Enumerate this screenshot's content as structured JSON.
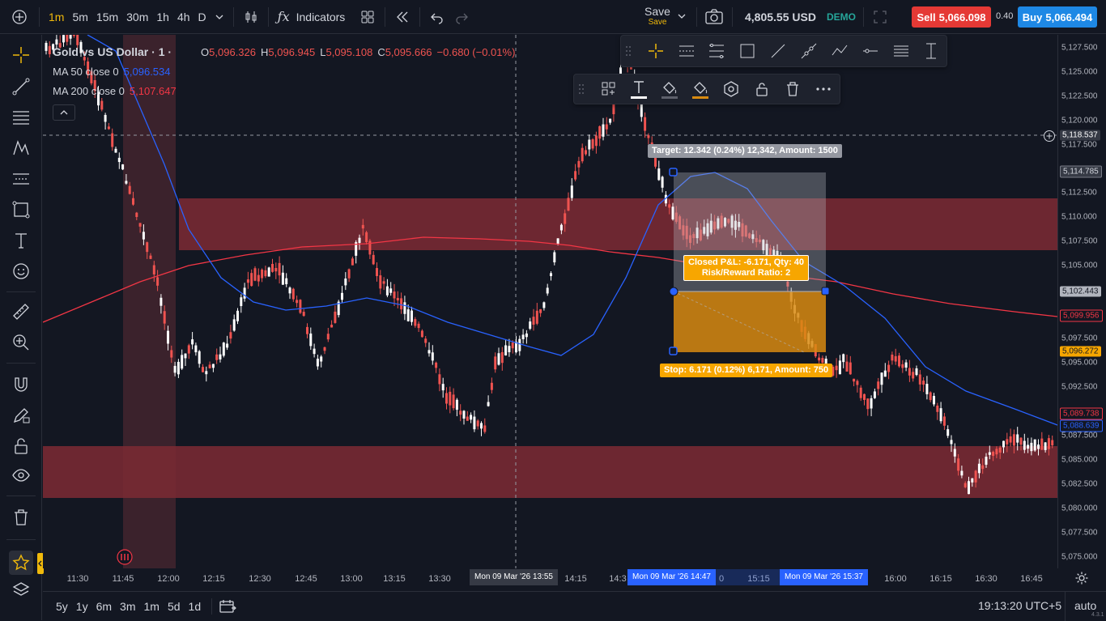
{
  "toolbar": {
    "timeframes": [
      "1m",
      "5m",
      "15m",
      "30m",
      "1h",
      "4h",
      "D"
    ],
    "indicators_label": "Indicators",
    "save_label": "Save",
    "save_sub": "Save",
    "balance": "4,805.55 USD",
    "account_mode": "DEMO",
    "sell_label": "Sell",
    "sell_price": "5,066.098",
    "spread": "0.40",
    "buy_label": "Buy",
    "buy_price": "5,066.494"
  },
  "legend": {
    "symbol": "Gold vs US Dollar · 1 ·",
    "open_label": "O",
    "open": "5,096.326",
    "high_label": "H",
    "high": "5,096.945",
    "low_label": "L",
    "low": "5,095.108",
    "close_label": "C",
    "close": "5,095.666",
    "change": "−0.680 (−0.01%)",
    "ma50_name": "MA 50 close 0",
    "ma50_value": "5,096.534",
    "ma200_name": "MA 200 close 0",
    "ma200_value": "5,107.647"
  },
  "position": {
    "target_label": "Target: 12.342 (0.24%) 12,342, Amount: 1500",
    "stop_label": "Stop: 6.171 (0.12%) 6,171, Amount: 750",
    "pnl_line1": "Closed P&L: -6.171, Qty: 40",
    "pnl_line2": "Risk/Reward Ratio: 2"
  },
  "price_scale": {
    "ticks": [
      "5,127.500",
      "5,125.000",
      "5,122.500",
      "5,120.000",
      "5,117.500",
      "5,112.500",
      "5,110.000",
      "5,107.500",
      "5,105.000",
      "5,097.500",
      "5,095.000",
      "5,092.500",
      "5,087.500",
      "5,085.000",
      "5,082.500",
      "5,080.000",
      "5,077.500",
      "5,075.000"
    ],
    "crosshair_price": "5,118.537",
    "target_price": "5,114.785",
    "entry_price": "5,102.443",
    "ma200_price": "5,099.956",
    "stop_price": "5,096.272",
    "last_price": "5,089.738",
    "ma50_price": "5,088.639"
  },
  "time_scale": {
    "ticks": [
      "11:30",
      "11:45",
      "12:00",
      "12:15",
      "12:30",
      "12:45",
      "13:00",
      "13:15",
      "13:30",
      "14:15",
      "15:15",
      "16:00",
      "16:15",
      "16:30",
      "16:45"
    ],
    "crosshair_time": "Mon 09 Mar '26   13:55",
    "start_time": "Mon 09 Mar '26   14:47",
    "end_time": "Mon 09 Mar '26   15:37",
    "partial_left": "14:3",
    "partial_right": "0"
  },
  "bottom": {
    "ranges": [
      "5y",
      "1y",
      "6m",
      "3m",
      "1m",
      "5d",
      "1d"
    ],
    "clock": "19:13:20 UTC+5",
    "scale_mode": "auto",
    "version": "4.3.1"
  },
  "colors": {
    "background": "#131722",
    "up": "#ffffff",
    "down": "#ef5350",
    "ma50": "#2962ff",
    "ma200": "#f23645",
    "zone": "#7a2a33",
    "stop_zone": "#b8720f",
    "accent": "#f0b90b"
  }
}
